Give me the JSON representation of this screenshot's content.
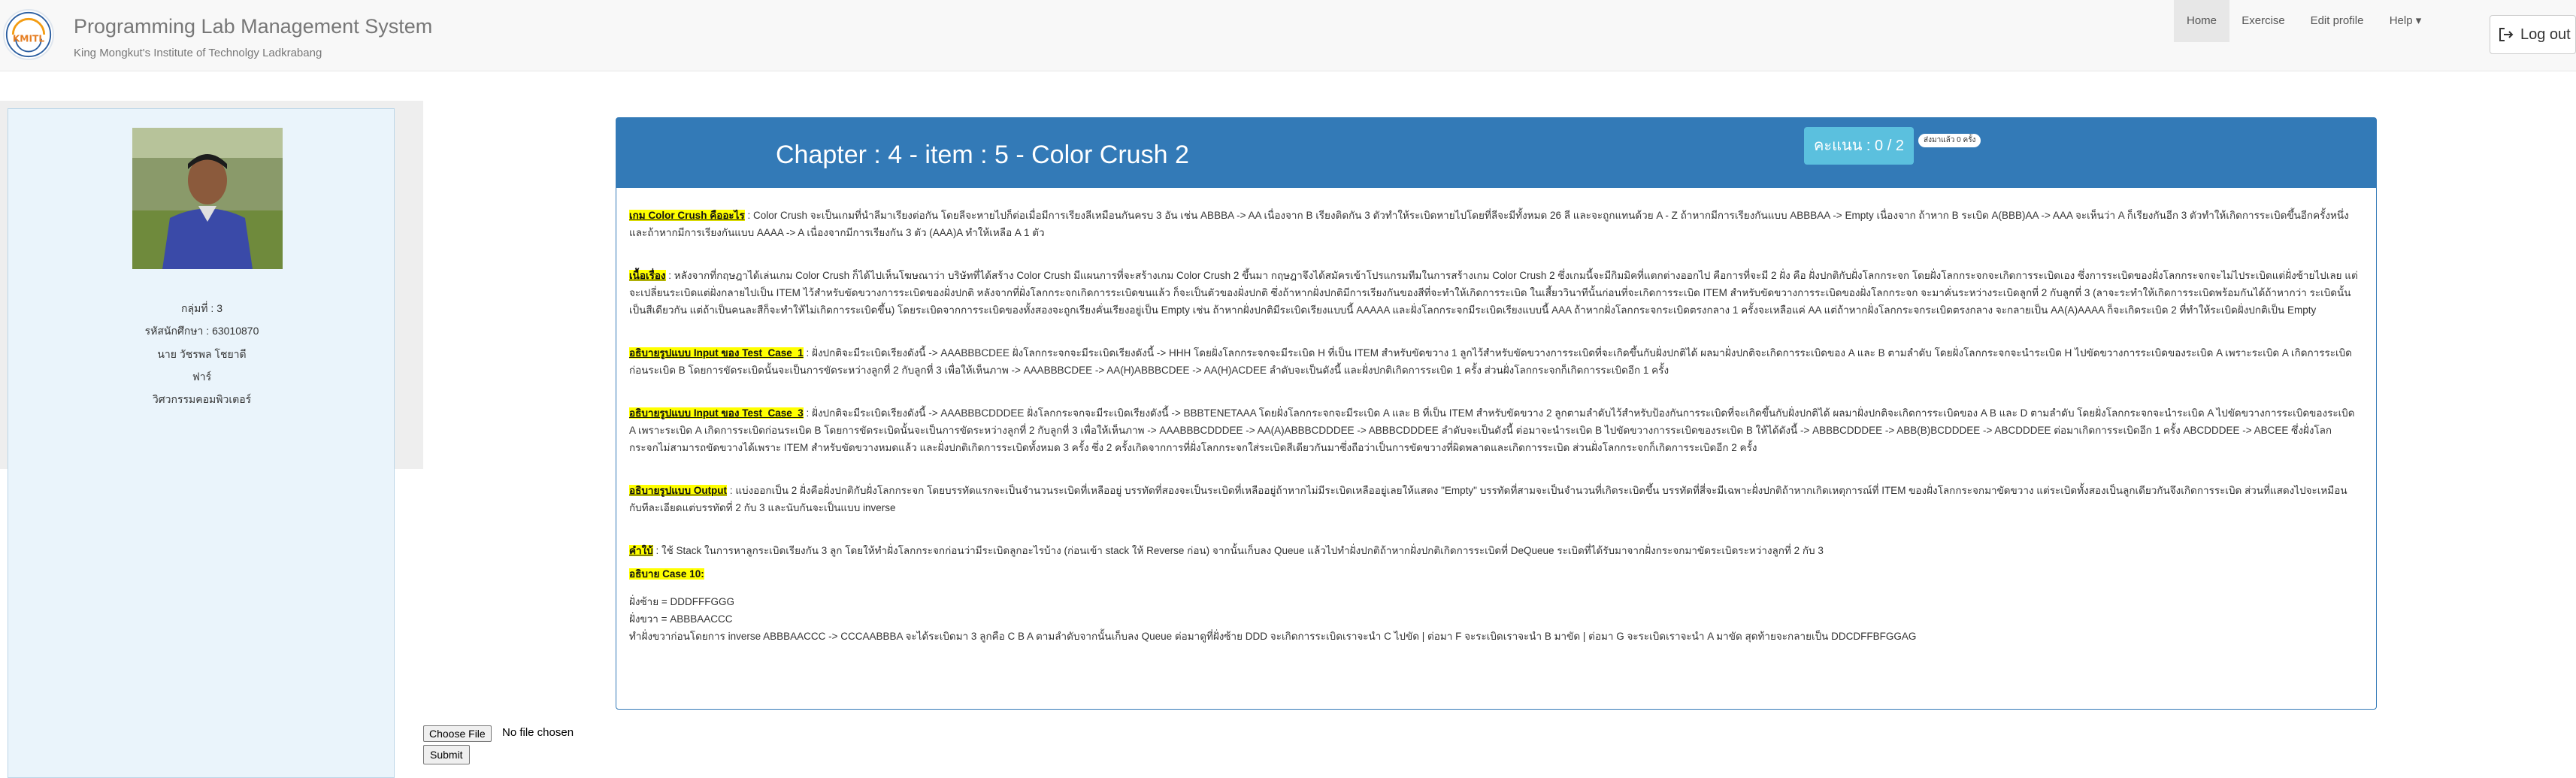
{
  "navbar": {
    "title": "Programming Lab Management System",
    "subtitle": "King Mongkut's Institute of Technolgy Ladkrabang",
    "logo_text": "KMITL",
    "items": [
      {
        "label": "Home",
        "active": true
      },
      {
        "label": "Exercise",
        "active": false
      },
      {
        "label": "Edit profile",
        "active": false
      },
      {
        "label": "Help ▾",
        "active": false
      }
    ],
    "logout_label": "Log out",
    "logout_icon": "logout-icon"
  },
  "profile": {
    "group": "กลุ่มที่ : 3",
    "student_id": "รหัสนักศึกษา : 63010870",
    "name": "นาย วัชรพล โชยาดี",
    "nickname": "ฟาร์",
    "faculty": "วิศวกรรมคอมพิวเตอร์"
  },
  "problem": {
    "title": "Chapter : 4 - item : 5 - Color Crush 2",
    "score": "คะแนน : 0 / 2",
    "submitted_badge": "ส่งมาแล้ว 0 ครั้ง",
    "paragraphs": [
      {
        "label": "เกม Color Crush คืออะไร",
        "text": " : Color Crush จะเป็นเกมที่นำลีมาเรียงต่อกัน โดยลีจะหายไปก็ต่อเมื่อมีการเรียงลีเหมือนกันครบ 3 อัน เช่น  ABBBA  -> AA  เนื่องจาก B เรียงติดกัน 3 ตัวทำให้ระเบิดหายไปโดยที่ลีจะมีทั้งหมด 26 ลี และจะถูกแทนด้วย A - Z  ถ้าหากมีการเรียงกันแบบ  ABBBAA -> Empty  เนื่องจาก  ถ้าหาก B ระเบิด  A(BBB)AA -> AAA จะเห็นว่า A ก็เรียงกันอีก 3 ตัวทำให้เกิดการระเบิดขึ้นอีกครั้งหนึ่ง  และถ้าหากมีการเรียงกันแบบ AAAA -> A เนื่องจากมีการเรียงกัน 3 ตัว  (AAA)A ทำให้เหลือ A 1 ตัว",
        "underline": true
      },
      {
        "label": "เนื้อเรื่อง",
        "text": " : หลังจากที่กฤษฎาได้เล่นเกม Color Crush ก็ได้ไปเห็นโฆษณาว่า บริษัทที่ได้สร้าง Color Crush มีแผนการที่จะสร้างเกม Color Crush 2 ขึ้นมา กฤษฎาจึงได้สมัครเข้าโปรแกรมทีมในการสร้างเกม Color Crush 2 ซึ่งเกมนี้จะมีกิมมิคที่แตกต่างออกไป คือการที่จะมี 2 ฝั่ง คือ ฝั่งปกติกับฝั่งโลกกระจก โดยฝั่งโลกกระจกจะเกิดการระเบิดเอง ซึ่งการระเบิดของฝั่งโลกกระจกจะไม่ไประเบิดแต่ฝั่งซ้ายไปเลย แต่จะเปลี่ยนระเบิดแต่ฝั่งกลายไปเป็น ITEM ไว้สำหรับขัดขวางการระเบิดของฝั่งปกติ  หลังจากที่ฝั่งโลกกระจกเกิดการระเบิดขนแล้ว ก็จะเป็นตัวของฝั่งปกติ  ซึ่งถ้าหากฝั่งปกติมีการเรียงกันของสีที่จะทำให้เกิดการระเบิด ในเสี้ยววินาทีนั้นก่อนที่จะเกิดการระเบิด  ITEM สำหรับขัดขวางการระเบิดของฝั่งโลกกระจก จะมาคั่นระหว่างระเบิดลูกที่ 2 กับลูกที่ 3 (ลาจะระทำให้เกิดการระเบิดพร้อมกันได้ถ้าหากว่า ระเบิดนั้นเป็นสีเดียวกัน  แต่ถ้าเป็นคนละสีก็จะทำให้ไม่เกิดการระเบิดขึ้น)  โดยระเบิดจากการระเบิดของทั้งสองจะถูกเรียงคั่นเรียงอยู่เป็น Empty  เช่น ถ้าหากฝั่งปกติมีระเบิดเรียงแบบนี้ AAAAA และฝั่งโลกกระจกมีระเบิดเรียงแบบนี้ AAA ถ้าหากฝั่งโลกกระจกระเบิดตรงกลาง 1 ครั้งจะเหลือแค่ AA แต่ถ้าหากฝั่งโลกกระจกระเบิดตรงกลาง จะกลายเป็น AA(A)AAAA ก็จะเกิดระเบิด 2 ที่ทำให้ระเบิดฝั่งปกติเป็น Empty",
        "underline": true
      },
      {
        "label": "อธิบายรูปแบบ Input ของ Test_Case_1",
        "text": " : ฝั่งปกติจะมีระเบิดเรียงดังนี้ -> AAABBBCDEE  ฝั่งโลกกระจกจะมีระเบิดเรียงดังนี้ -> HHH โดยฝั่งโลกกระจกจะมีระเบิด H ที่เป็น ITEM สำหรับขัดขวาง 1 ลูกไว้สำหรับขัดขวางการระเบิดที่จะเกิดขึ้นกับฝั่งปกติได้  ผลมาฝั่งปกติจะเกิดการระเบิดของ A และ B ตามลำดับ  โดยฝั่งโลกกระจกจะนำระเบิด H ไปขัดขวางการระเบิดของระเบิด A เพราะระเบิด A เกิดการระเบิดก่อนระเบิด B  โดยการขัดระเบิดนั้นจะเป็นการขัดระหว่างลูกที่ 2 กับลูกที่ 3 เพื่อให้เห็นภาพ -> AAABBBCDEE -> AA(H)ABBBCDEE  -> AA(H)ACDEE ลำดับจะเป็นดังนี้  และฝั่งปกติเกิดการระเบิด 1 ครั้ง ส่วนฝั่งโลกกระจกก็เกิดการระเบิดอีก 1 ครั้ง",
        "underline": true
      },
      {
        "label": "อธิบายรูปแบบ Input ของ Test_Case_3",
        "text": " : ฝั่งปกติจะมีระเบิดเรียงดังนี้ -> AAABBBCDDDEE  ฝั่งโลกกระจกจะมีระเบิดเรียงดังนี้ -> BBBTENETAAA โดยฝั่งโลกกระจกจะมีระเบิด A และ B ที่เป็น ITEM สำหรับขัดขวาง 2 ลูกตามลำดับไว้สำหรับป้องกันการระเบิดที่จะเกิดขึ้นกับฝั่งปกติได้  ผลมาฝั่งปกติจะเกิดการระเบิดของ A B และ D ตามลำดับ  โดยฝั่งโลกกระจกจะนำระเบิด A  ไปขัดขวางการระเบิดของระเบิด A เพราะระเบิด A เกิดการระเบิดก่อนระเบิด B  โดยการขัดระเบิดนั้นจะเป็นการขัดระหว่างลูกที่ 2 กับลูกที่ 3  เพื่อให้เห็นภาพ -> AAABBBCDDDEE -> AA(A)ABBBCDDDEE -> ABBBCDDDEE ลำดับจะเป็นดังนี้  ต่อมาจะนำระเบิด B ไปขัดขวางการระเบิดของระเบิด B ให้ได้ดังนี้ -> ABBBCDDDEE -> ABB(B)BCDDDEE -> ABCDDDEE  ต่อมาเกิดการระเบิดอีก 1 ครั้ง ABCDDDEE -> ABCEE ซึ่งฝั่งโลกกระจกไม่สามารถขัดขวางได้เพราะ ITEM สำหรับขัดขวางหมดแล้ว   และฝั่งปกติเกิดการระเบิดทั้งหมด 3 ครั้ง  ซึ่ง 2 ครั้งเกิดจากการที่ฝั่งโลกกระจกใส่ระเบิดสีเดียวกันมาซึ่งถือว่าเป็นการขัดขวางที่ผิดพลาดและเกิดการระเบิด ส่วนฝั่งโลกกระจกก็เกิดการระเบิดอีก 2 ครั้ง",
        "underline": true
      },
      {
        "label": "อธิบายรูปแบบ Output",
        "text": " : แบ่งออกเป็น 2 ฝั่งคือฝั่งปกติกับฝั่งโลกกระจก  โดยบรรทัดแรกจะเป็นจำนวนระเบิดที่เหลืออยู่  บรรทัดที่สองจะเป็นระเบิดที่เหลืออยู่ถ้าหากไม่มีระเบิดเหลืออยู่เลยให้แสดง \"Empty\" บรรทัดที่สามจะเป็นจำนวนที่เกิดระเบิดขึ้น บรรทัดที่สี่จะมีเฉพาะฝั่งปกติถ้าหากเกิดเหตุการณ์ที่ ITEM ของฝั่งโลกกระจกมาขัดขวาง แต่ระเบิดทั้งสองเป็นลูกเดียวกันจึงเกิดการระเบิด  ส่วนที่แสดงไปจะเหมือนกับทีละเอียดแต่บรรทัดที่ 2 กับ 3 และนับกันจะเป็นแบบ inverse",
        "underline": true
      },
      {
        "label": "คำใบ้",
        "text": " : ใช้ Stack ในการหาลูกระเบิดเรียงกัน 3 ลูก  โดยให้ทำฝั่งโลกกระจกก่อนว่ามีระเบิดลูกอะไรบ้าง (ก่อนเข้า stack ให้ Reverse ก่อน)  จากนั้นเก็บลง Queue แล้วไปทำฝั่งปกติถ้าหากฝั่งปกติเกิดการระเบิดที่ DeQueue ระเบิดที่ได้รับมาจากฝั่งกระจกมาขัดระเบิดระหว่างลูกที่ 2 กับ 3",
        "underline": true
      }
    ],
    "example": {
      "label": "อธิบาย Case 10:",
      "lines": [
        "ฝั่งซ้าย = DDDFFFGGG",
        "ฝั่งขวา = ABBBAACCC",
        "ทำฝั่งขวาก่อนโดยการ inverse ABBBAACCC -> CCCAABBBA จะได้ระเบิดมา 3 ลูกคือ C B A ตามลำดับจากนั้นเก็บลง Queue ต่อมาดูที่ฝั่งซ้าย DDD จะเกิดการระเบิดเราจะนำ C ไปขัด | ต่อมา F จะระเบิดเราจะนำ B มาขัด | ต่อมา G จะระเบิดเราจะนำ A มาขัด   สุดท้ายจะกลายเป็น DDCDFFBFGGAG"
      ]
    }
  },
  "upload": {
    "choose_label": "Choose File",
    "no_file": "No file chosen",
    "submit_label": "Submit"
  }
}
